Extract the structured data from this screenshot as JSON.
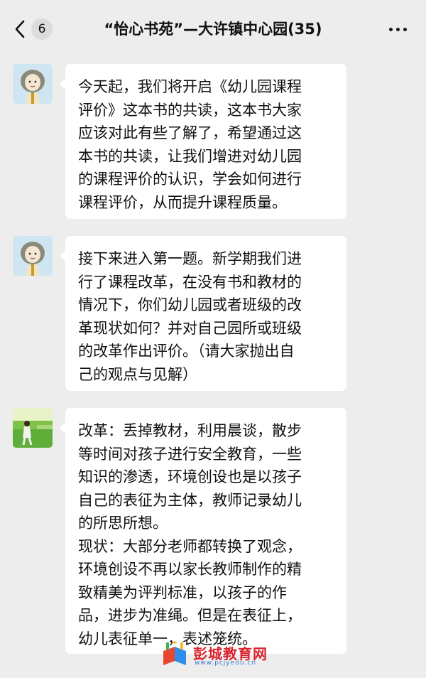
{
  "header": {
    "back_label": "6",
    "title": "“怡心书苑”—大许镇中心园(35)"
  },
  "messages": [
    {
      "avatar": "elder-woman-avatar",
      "text": "今天起，我们将开启《幼儿园课程\n评价》这本书的共读，这本书大家\n应该对此有些了解了，希望通过这\n本书的共读，让我们增进对幼儿园\n的课程评价的认识，学会如何进行\n课程评价，从而提升课程质量。"
    },
    {
      "avatar": "elder-woman-avatar",
      "text": "接下来进入第一题。新学期我们进\n行了课程改革，在没有书和教材的\n情况下，你们幼儿园或者班级的改\n革现状如何？并对自己园所或班级\n的改革作出评价。（请大家抛出自\n己的观点与见解）"
    },
    {
      "avatar": "walking-person-avatar",
      "text": "改革：丢掉教材，利用晨谈，散步\n等时间对孩子进行安全教育，一些\n知识的渗透，环境创设也是以孩子\n自己的表征为主体，教师记录幼儿\n的所思所想。\n现状：大部分老师都转换了观念，\n环境创设不再以家长教师制作的精\n致精美为评判标准，以孩子的作\n品，进步为准绳。但是在表征上，\n幼儿表征单一，表述笼统。"
    }
  ],
  "watermark": {
    "title": "彭城教育网",
    "url": "www.pcjyedu.cn"
  },
  "colors": {
    "background": "#ededed",
    "bubble": "#ffffff",
    "text": "#111111",
    "watermark_red": "#d9232d",
    "watermark_blue": "#3a7bd5"
  }
}
